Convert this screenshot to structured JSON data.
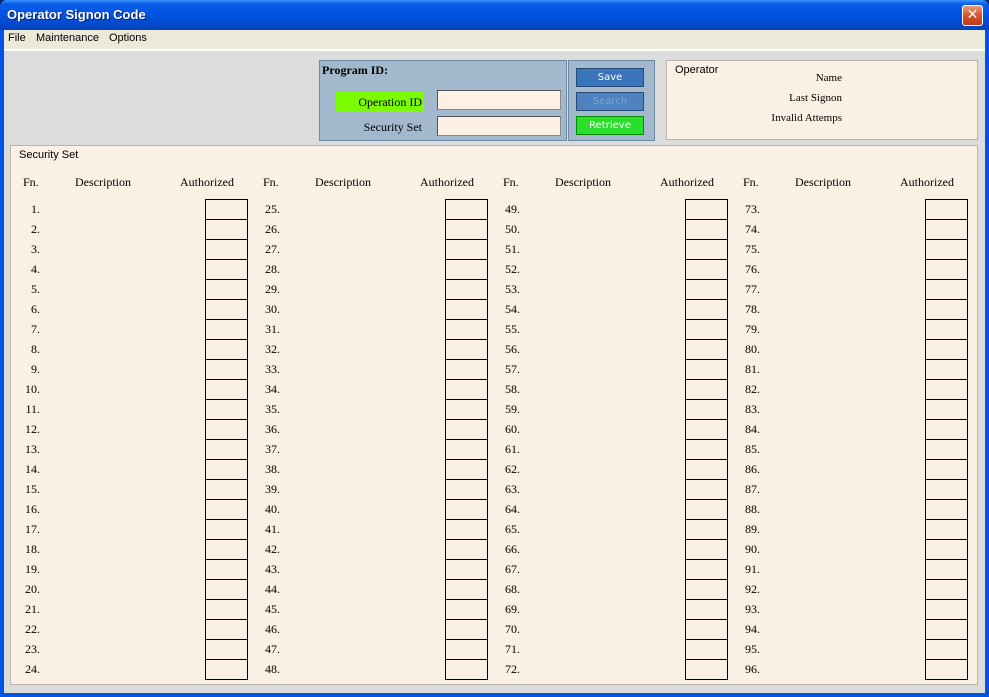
{
  "window": {
    "title": "Operator Signon Code",
    "close_glyph": "✕"
  },
  "menu": [
    "File",
    "Maintenance",
    "Options"
  ],
  "program": {
    "label": "Program ID:",
    "operation_id_label": "Operation ID",
    "operation_id_value": "",
    "security_set_label": "Security Set",
    "security_set_value": ""
  },
  "buttons": {
    "save": "Save",
    "search": "Search",
    "retrieve": "Retrieve"
  },
  "operator": {
    "title": "Operator",
    "name_label": "Name",
    "last_signon_label": "Last Signon",
    "invalid_attempts_label": "Invalid Attemps"
  },
  "security": {
    "title": "Security Set",
    "headers": {
      "fn": "Fn.",
      "description": "Description",
      "authorized": "Authorized"
    },
    "columns": [
      [
        "1.",
        "2.",
        "3.",
        "4.",
        "5.",
        "6.",
        "7.",
        "8.",
        "9.",
        "10.",
        "11.",
        "12.",
        "13.",
        "14.",
        "15.",
        "16.",
        "17.",
        "18.",
        "19.",
        "20.",
        "21.",
        "22.",
        "23.",
        "24."
      ],
      [
        "25.",
        "26.",
        "27.",
        "28.",
        "29.",
        "30.",
        "31.",
        "32.",
        "33.",
        "34.",
        "35.",
        "36.",
        "37.",
        "38.",
        "39.",
        "40.",
        "41.",
        "42.",
        "43.",
        "44.",
        "45.",
        "46.",
        "47.",
        "48."
      ],
      [
        "49.",
        "50.",
        "51.",
        "52.",
        "53.",
        "54.",
        "55.",
        "56.",
        "57.",
        "58.",
        "59.",
        "60.",
        "61.",
        "62.",
        "63.",
        "64.",
        "65.",
        "66.",
        "67.",
        "68.",
        "69.",
        "70.",
        "71.",
        "72."
      ],
      [
        "73.",
        "74.",
        "75.",
        "76.",
        "77.",
        "78.",
        "79.",
        "80.",
        "81.",
        "82.",
        "83.",
        "84.",
        "85.",
        "86.",
        "87.",
        "88.",
        "89.",
        "90.",
        "91.",
        "92.",
        "93.",
        "94.",
        "95.",
        "96."
      ]
    ]
  },
  "colors": {
    "title_bar": "#0054e3",
    "panel_bg": "#fbf0e4",
    "program_panel": "#a1b8cd",
    "operation_id_highlight": "#7cfc00",
    "retrieve_button": "#2adf2a"
  }
}
